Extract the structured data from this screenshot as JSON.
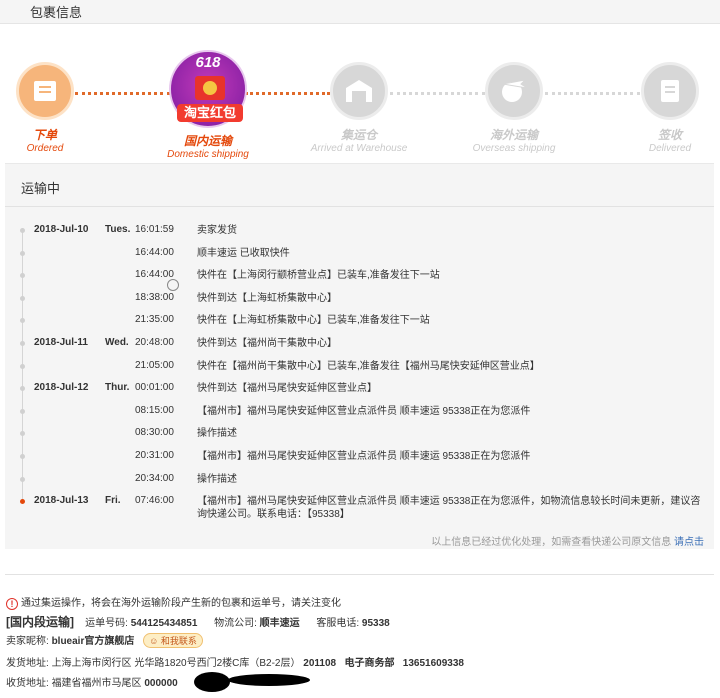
{
  "header": {
    "title": "包裹信息"
  },
  "steps": [
    {
      "cn": "下单",
      "en": "Ordered",
      "state": "done"
    },
    {
      "cn": "国内运输",
      "en": "Domestic shipping",
      "state": "active"
    },
    {
      "cn": "集运仓",
      "en": "Arrived at Warehouse",
      "state": "pending"
    },
    {
      "cn": "海外运输",
      "en": "Overseas shipping",
      "state": "pending"
    },
    {
      "cn": "签收",
      "en": "Delivered",
      "state": "pending"
    }
  ],
  "promo": {
    "number": "618",
    "label": "淘宝红包"
  },
  "panel": {
    "title": "运输中",
    "events": [
      {
        "date": "2018-Jul-10",
        "weekday": "Tues.",
        "time": "16:01:59",
        "text": "卖家发货"
      },
      {
        "date": "",
        "weekday": "",
        "time": "16:44:00",
        "text": "顺丰速运 已收取快件"
      },
      {
        "date": "",
        "weekday": "",
        "time": "16:44:00",
        "text": "快件在【上海闵行颛桥营业点】已装车,准备发往下一站"
      },
      {
        "date": "",
        "weekday": "",
        "time": "18:38:00",
        "text": "快件到达【上海虹桥集散中心】"
      },
      {
        "date": "",
        "weekday": "",
        "time": "21:35:00",
        "text": "快件在【上海虹桥集散中心】已装车,准备发往下一站"
      },
      {
        "date": "2018-Jul-11",
        "weekday": "Wed.",
        "time": "20:48:00",
        "text": "快件到达【福州尚干集散中心】"
      },
      {
        "date": "",
        "weekday": "",
        "time": "21:05:00",
        "text": "快件在【福州尚干集散中心】已装车,准备发往【福州马尾快安延伸区营业点】"
      },
      {
        "date": "2018-Jul-12",
        "weekday": "Thur.",
        "time": "00:01:00",
        "text": "快件到达【福州马尾快安延伸区营业点】"
      },
      {
        "date": "",
        "weekday": "",
        "time": "08:15:00",
        "text": "【福州市】福州马尾快安延伸区营业点派件员 顺丰速运 95338正在为您派件"
      },
      {
        "date": "",
        "weekday": "",
        "time": "08:30:00",
        "text": "操作描述"
      },
      {
        "date": "",
        "weekday": "",
        "time": "20:31:00",
        "text": "【福州市】福州马尾快安延伸区营业点派件员 顺丰速运 95338正在为您派件"
      },
      {
        "date": "",
        "weekday": "",
        "time": "20:34:00",
        "text": "操作描述"
      },
      {
        "date": "2018-Jul-13",
        "weekday": "Fri.",
        "time": "07:46:00",
        "text": "【福州市】福州马尾快安延伸区营业点派件员 顺丰速运 95338正在为您派件，如物流信息较长时间未更新，建议咨询快递公司。联系电话：【95338】"
      }
    ],
    "note": "以上信息已经过优化处理，如需查看快递公司原文信息",
    "note_link": "请点击"
  },
  "info": {
    "warning": "通过集运操作，将会在海外运输阶段产生新的包裹和运单号，请关注变化",
    "section": "[国内段运输]",
    "waybill_label": "运单号码:",
    "waybill": "544125434851",
    "carrier_label": "物流公司:",
    "carrier": "顺丰速运",
    "phone_label": "客服电话:",
    "phone": "95338",
    "seller_label": "卖家昵称:",
    "seller": "blueair官方旗舰店",
    "contact": "和我联系",
    "ship_label": "发货地址:",
    "ship_addr": "上海上海市闵行区 光华路1820号西门2楼C库（B2-2层）",
    "ship_zip": "201108",
    "ship_dept": "电子商务部",
    "ship_phone": "13651609338",
    "recv_label": "收货地址:",
    "recv_addr": "福建省福州市马尾区",
    "recv_zip": "000000"
  }
}
